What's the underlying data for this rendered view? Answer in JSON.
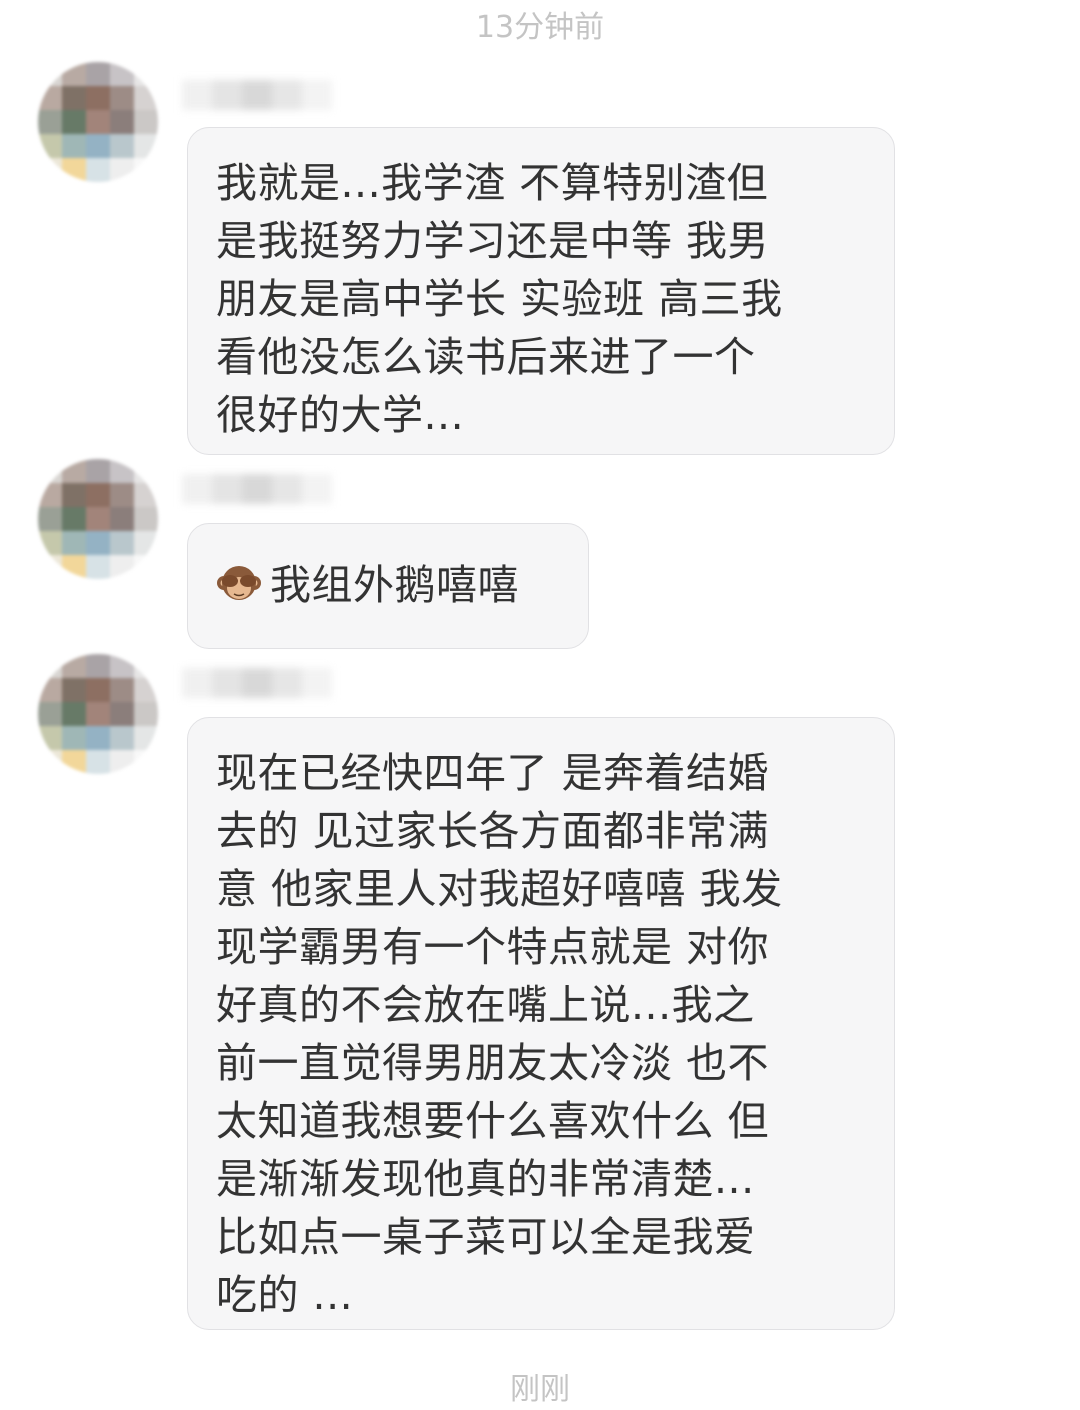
{
  "timestamps": {
    "top": "13分钟前",
    "bottom": "刚刚"
  },
  "messages": [
    {
      "lines": [
        "我就是...我学渣 不算特别渣但",
        "是我挺努力学习还是中等 我男",
        "朋友是高中学长 实验班 高三我",
        "看他没怎么读书后来进了一个",
        "很好的大学..."
      ]
    },
    {
      "icon": "see-no-evil-monkey-emoji",
      "lines": [
        "我组外鹅嘻嘻"
      ]
    },
    {
      "lines": [
        "现在已经快四年了 是奔着结婚",
        "去的 见过家长各方面都非常满",
        "意 他家里人对我超好嘻嘻 我发",
        "现学霸男有一个特点就是 对你",
        "好真的不会放在嘴上说...我之",
        "前一直觉得男朋友太冷淡 也不",
        "太知道我想要什么喜欢什么 但",
        "是渐渐发现他真的非常清楚...",
        "比如点一桌子菜可以全是我爱",
        "吃的 ..."
      ]
    }
  ],
  "colors": {
    "bubble_bg": "#f6f6f7",
    "bubble_border": "#e1e1e4",
    "text": "#333333",
    "timestamp": "#c4c4c4"
  }
}
